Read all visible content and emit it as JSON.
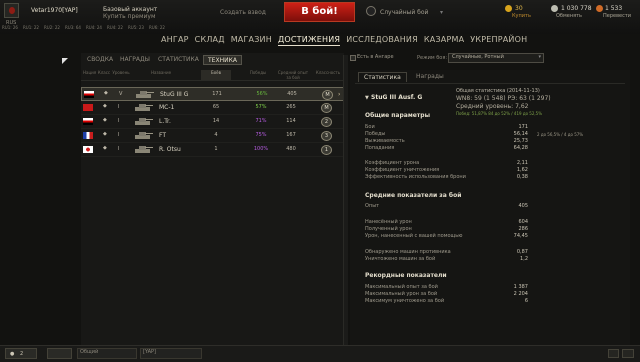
{
  "header": {
    "flag_label": "RUS",
    "username": "Vetar1970[YAP]",
    "premium_line1": "Базовый аккаунт",
    "premium_line2": "Купить премиум",
    "create_squad": "Создать взвод",
    "battle_button": "В бой!",
    "battle_type": "Случайный бой",
    "gold_value": "30",
    "gold_label": "Купить",
    "credits_value": "1 030 778",
    "credits_label": "Обменять",
    "xp_value": "1 533",
    "xp_label": "Перевести"
  },
  "tiers": [
    "RU1: 26",
    "RU1: 22",
    "RU2: 22",
    "RU3: 64",
    "RU4: 24",
    "RU4: 22",
    "RU5: 23",
    "RU6: 22"
  ],
  "nav": [
    "АНГАР",
    "СКЛАД",
    "МАГАЗИН",
    "ДОСТИЖЕНИЯ",
    "ИССЛЕДОВАНИЯ",
    "КАЗАРМА",
    "УКРЕПРАЙОН"
  ],
  "nav_active": "ДОСТИЖЕНИЯ",
  "subtabs": [
    "СВОДКА",
    "НАГРАДЫ",
    "СТАТИСТИКА",
    "ТЕХНИКА"
  ],
  "subtab_active": "ТЕХНИКА",
  "filter": {
    "label": "Есть в Ангаре",
    "mode_label": "Режим боя:",
    "mode_value": "Случайные, Ротный"
  },
  "table": {
    "headers": [
      "Нация",
      "Класс",
      "Уровень",
      "Название",
      "Боёв",
      "Победы",
      "Средний опыт за бой",
      "Классность"
    ],
    "rows": [
      {
        "nation": "germany",
        "tier": "V",
        "name": "StuG III G",
        "battles": "171",
        "wins": "56%",
        "win_color": "#68b83d",
        "xp": "405",
        "badge": "М"
      },
      {
        "nation": "ussr",
        "tier": "I",
        "name": "MC-1",
        "battles": "65",
        "wins": "57%",
        "win_color": "#7fcf4a",
        "xp": "265",
        "badge": "М"
      },
      {
        "nation": "germany",
        "tier": "I",
        "name": "L.Tr.",
        "battles": "14",
        "wins": "71%",
        "win_color": "#b55ce0",
        "xp": "114",
        "badge": "2"
      },
      {
        "nation": "france",
        "tier": "I",
        "name": "FT",
        "battles": "4",
        "wins": "75%",
        "win_color": "#b55ce0",
        "xp": "167",
        "badge": "3"
      },
      {
        "nation": "japan",
        "tier": "I",
        "name": "R. Otsu",
        "battles": "1",
        "wins": "100%",
        "win_color": "#b55ce0",
        "xp": "480",
        "badge": "1"
      }
    ]
  },
  "right": {
    "tabs": [
      "Статистика",
      "Награды"
    ],
    "tab_active": "Статистика",
    "tank_title": "StuG III Ausf. G",
    "general_title": "Общая статистика (2014-11-13)",
    "wn8": "WN8: 59 (1 548) РЭ: 63 (1 297)",
    "avg_tier": "Средний уровень: 7,62",
    "victories_line": "Побед: 51,87%   84 до 52% / 419 до 52,5%",
    "sections": [
      {
        "title": "Общие параметры",
        "items": [
          {
            "label": "Бои",
            "value": "171"
          },
          {
            "label": "Победы",
            "value": "56,14"
          },
          {
            "label": "Выживаемость",
            "value": "25,73"
          },
          {
            "label": "Попадания",
            "value": "64,28"
          }
        ]
      },
      {
        "title": "",
        "items": [
          {
            "label": "Коэффициент урона",
            "value": "2,11"
          },
          {
            "label": "Коэффициент уничтожения",
            "value": "1,62"
          },
          {
            "label": "Эффективность использования брони",
            "value": "0,38"
          }
        ]
      },
      {
        "title": "Средние показатели за бой",
        "items": [
          {
            "label": "Опыт",
            "value": "405"
          },
          {
            "label": "Нанесённый урон",
            "value": "604"
          },
          {
            "label": "Полученный урон",
            "value": "286"
          },
          {
            "label": "Урон, нанесенный с вашей помощью",
            "value": "74,45"
          },
          {
            "label": "Обнаружено машин противника",
            "value": "0,87"
          },
          {
            "label": "Уничтожено машин за бой",
            "value": "1,2"
          }
        ]
      },
      {
        "title": "Рекордные показатели",
        "items": [
          {
            "label": "Максимальный опыт за бой",
            "value": "1 387"
          },
          {
            "label": "Максимальный урон за бой",
            "value": "2 204"
          },
          {
            "label": "Максимум уничтожено за бой",
            "value": "6"
          }
        ]
      }
    ],
    "wins_extra": "2 до 56,5% / 4 до 57%"
  },
  "footer": {
    "friends": "2",
    "chat_general": "Общий",
    "chat_clan": "[YAP]"
  }
}
